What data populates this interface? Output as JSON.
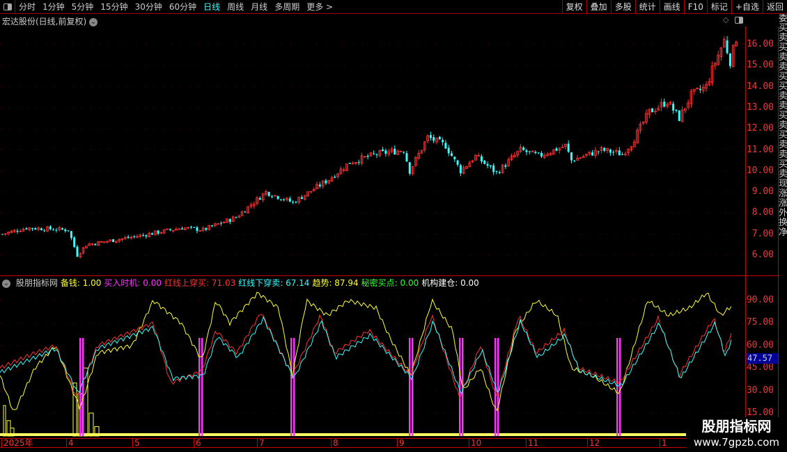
{
  "toolbar": {
    "periods": [
      "分时",
      "1分钟",
      "5分钟",
      "15分钟",
      "30分钟",
      "60分钟",
      "日线",
      "周线",
      "月线",
      "多周期",
      "更多 >"
    ],
    "active": "日线",
    "buttons": [
      "复权",
      "叠加",
      "多股",
      "统计",
      "画线",
      "F10",
      "标记",
      "+自选",
      "返回"
    ]
  },
  "title": "宏达股份(日线,前复权)",
  "price_axis": [
    "16.00",
    "15.00",
    "14.00",
    "13.00",
    "12.00",
    "11.00",
    "10.00",
    "9.00",
    "8.00",
    "7.00",
    "6.00"
  ],
  "indicator": {
    "name": "股朋指标网",
    "items": [
      {
        "label": "备钱: 1.00",
        "color": "#ffff33"
      },
      {
        "label": "买入时机: 0.00",
        "color": "#ff33ff"
      },
      {
        "label": "红线上穿买: 71.03",
        "color": "#ff3333"
      },
      {
        "label": "红线下穿卖: 67.14",
        "color": "#33ffff"
      },
      {
        "label": "趋势: 87.94",
        "color": "#ffff33"
      },
      {
        "label": "秘密买点: 0.00",
        "color": "#33ff33"
      },
      {
        "label": "机构建仓: 0.00",
        "color": "#ffffff"
      }
    ],
    "axis": [
      "90.00",
      "75.00",
      "60.00",
      "45.00",
      "30.00",
      "15.00"
    ],
    "cursor_value": "47.57"
  },
  "dates": [
    "2025年",
    "4",
    "5",
    "6",
    "7",
    "8",
    "9",
    "10",
    "11",
    "12",
    "1"
  ],
  "watermark": {
    "line1": "股朋指标网",
    "line2": "www.7gpzb.com"
  },
  "side_strip": "委买卖买卖卖买买卖卖买卖买卖卖买卖现涨涨外换净",
  "chart_data": {
    "type": "candlestick",
    "price_keyframes": [
      [
        0,
        7.0
      ],
      [
        8,
        7.3
      ],
      [
        22,
        7.2
      ],
      [
        25,
        6.0
      ],
      [
        28,
        6.5
      ],
      [
        45,
        6.9
      ],
      [
        60,
        7.3
      ],
      [
        67,
        7.2
      ],
      [
        78,
        7.8
      ],
      [
        88,
        9.0
      ],
      [
        97,
        8.5
      ],
      [
        109,
        9.6
      ],
      [
        116,
        10.4
      ],
      [
        125,
        10.8
      ],
      [
        134,
        11.0
      ],
      [
        136,
        10.0
      ],
      [
        142,
        11.6
      ],
      [
        148,
        11.2
      ],
      [
        153,
        10.0
      ],
      [
        158,
        10.7
      ],
      [
        165,
        9.9
      ],
      [
        173,
        11.0
      ],
      [
        179,
        10.7
      ],
      [
        188,
        11.2
      ],
      [
        190,
        10.5
      ],
      [
        200,
        11.0
      ],
      [
        207,
        10.8
      ],
      [
        210,
        11.3
      ],
      [
        216,
        12.8
      ],
      [
        222,
        13.3
      ],
      [
        226,
        12.5
      ],
      [
        230,
        13.6
      ],
      [
        235,
        14.0
      ],
      [
        237,
        14.8
      ],
      [
        241,
        16.2
      ],
      [
        243,
        15.2
      ],
      [
        245,
        16.3
      ]
    ],
    "ylim": [
      5.5,
      16.8
    ],
    "indicator_series": {
      "trend_yellow": [
        [
          0,
          40
        ],
        [
          20,
          15
        ],
        [
          50,
          45
        ],
        [
          80,
          60
        ],
        [
          100,
          35
        ],
        [
          115,
          18
        ],
        [
          140,
          55
        ],
        [
          190,
          60
        ],
        [
          220,
          90
        ],
        [
          260,
          75
        ],
        [
          290,
          50
        ],
        [
          310,
          90
        ],
        [
          330,
          75
        ],
        [
          370,
          95
        ],
        [
          400,
          85
        ],
        [
          420,
          40
        ],
        [
          440,
          90
        ],
        [
          470,
          80
        ],
        [
          500,
          90
        ],
        [
          540,
          85
        ],
        [
          560,
          65
        ],
        [
          590,
          40
        ],
        [
          620,
          90
        ],
        [
          650,
          70
        ],
        [
          665,
          30
        ],
        [
          690,
          45
        ],
        [
          713,
          15
        ],
        [
          740,
          70
        ],
        [
          770,
          90
        ],
        [
          800,
          80
        ],
        [
          820,
          45
        ],
        [
          850,
          40
        ],
        [
          890,
          28
        ],
        [
          930,
          90
        ],
        [
          960,
          80
        ],
        [
          990,
          85
        ],
        [
          1015,
          95
        ],
        [
          1035,
          80
        ],
        [
          1052,
          87
        ]
      ],
      "red": [
        [
          0,
          45
        ],
        [
          50,
          55
        ],
        [
          80,
          60
        ],
        [
          110,
          25
        ],
        [
          140,
          60
        ],
        [
          220,
          75
        ],
        [
          245,
          35
        ],
        [
          290,
          43
        ],
        [
          310,
          70
        ],
        [
          340,
          55
        ],
        [
          375,
          82
        ],
        [
          420,
          40
        ],
        [
          460,
          80
        ],
        [
          480,
          55
        ],
        [
          530,
          70
        ],
        [
          590,
          40
        ],
        [
          620,
          80
        ],
        [
          660,
          25
        ],
        [
          690,
          60
        ],
        [
          713,
          25
        ],
        [
          745,
          80
        ],
        [
          770,
          55
        ],
        [
          810,
          70
        ],
        [
          830,
          45
        ],
        [
          890,
          35
        ],
        [
          945,
          78
        ],
        [
          975,
          40
        ],
        [
          1025,
          78
        ],
        [
          1040,
          55
        ],
        [
          1052,
          71
        ]
      ],
      "cyan": [
        [
          0,
          42
        ],
        [
          50,
          52
        ],
        [
          80,
          58
        ],
        [
          112,
          28
        ],
        [
          140,
          58
        ],
        [
          220,
          72
        ],
        [
          248,
          38
        ],
        [
          292,
          40
        ],
        [
          312,
          66
        ],
        [
          342,
          52
        ],
        [
          378,
          78
        ],
        [
          422,
          38
        ],
        [
          462,
          76
        ],
        [
          482,
          52
        ],
        [
          532,
          67
        ],
        [
          592,
          38
        ],
        [
          622,
          76
        ],
        [
          662,
          28
        ],
        [
          692,
          57
        ],
        [
          715,
          28
        ],
        [
          747,
          76
        ],
        [
          772,
          52
        ],
        [
          812,
          67
        ],
        [
          832,
          43
        ],
        [
          892,
          33
        ],
        [
          947,
          75
        ],
        [
          977,
          38
        ],
        [
          1027,
          75
        ],
        [
          1042,
          52
        ],
        [
          1052,
          67
        ]
      ],
      "buy_signals_x": [
        117,
        288,
        420,
        590,
        662,
        713,
        888
      ],
      "ylim": [
        5,
        100
      ]
    }
  }
}
